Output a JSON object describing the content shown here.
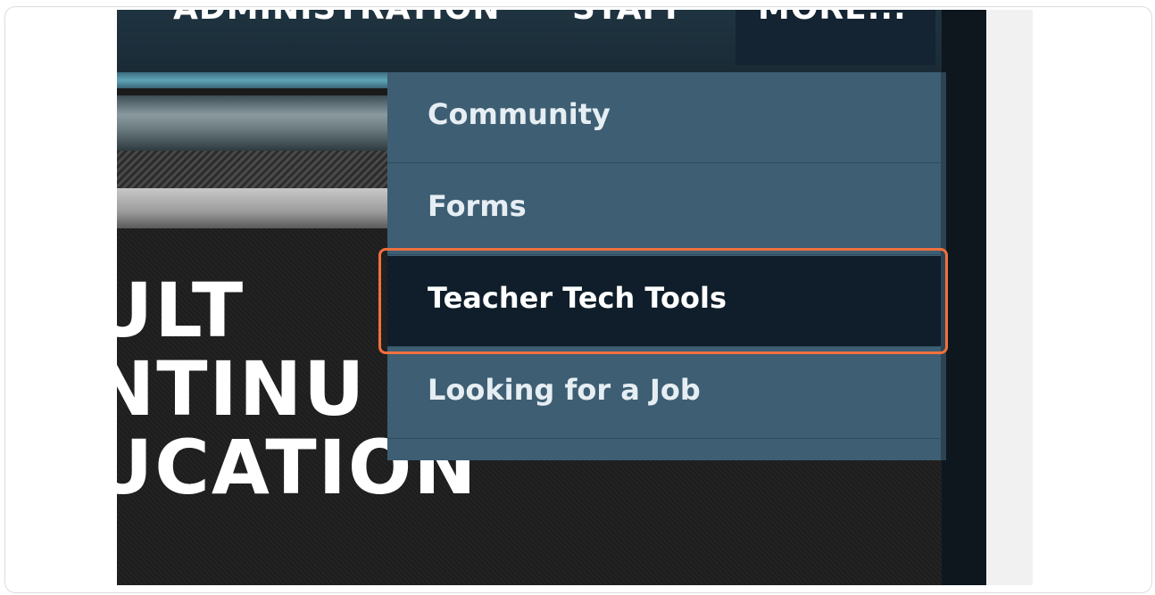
{
  "nav": {
    "items": [
      "ADMINISTRATION",
      "STAFF",
      "MORE..."
    ]
  },
  "dropdown": {
    "items": [
      {
        "label": "Community"
      },
      {
        "label": "Forms"
      },
      {
        "label": "Teacher Tech Tools",
        "active": true
      },
      {
        "label": "Looking for a Job"
      }
    ]
  },
  "banner": {
    "lines": [
      "ULT",
      "NTINU",
      "UCATION"
    ]
  },
  "colors": {
    "highlight": "#f0703e",
    "dropdown_bg": "#3e5e73",
    "active_item_bg": "#0f1e2a",
    "nav_bg": "#1f3340"
  }
}
